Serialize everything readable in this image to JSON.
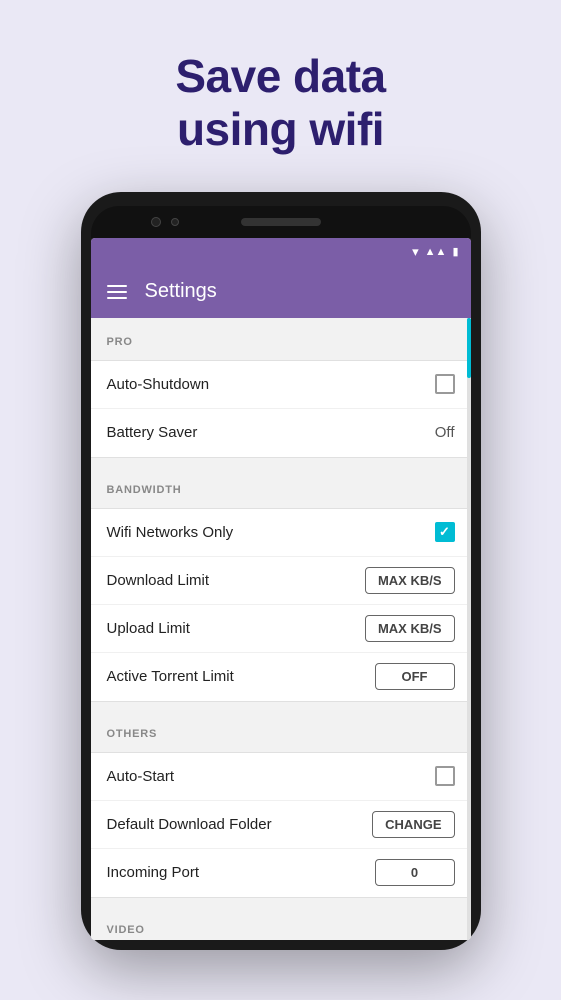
{
  "hero": {
    "line1": "Save data",
    "line2": "using wifi"
  },
  "appbar": {
    "title": "Settings"
  },
  "sections": {
    "pro": {
      "header": "PRO",
      "items": [
        {
          "label": "Auto-Shutdown",
          "control": "checkbox",
          "value": false
        },
        {
          "label": "Battery Saver",
          "control": "text",
          "value": "Off"
        }
      ]
    },
    "bandwidth": {
      "header": "BANDWIDTH",
      "items": [
        {
          "label": "Wifi Networks Only",
          "control": "checkbox-checked",
          "value": true
        },
        {
          "label": "Download Limit",
          "control": "button",
          "value": "MAX KB/S"
        },
        {
          "label": "Upload Limit",
          "control": "button",
          "value": "MAX KB/S"
        },
        {
          "label": "Active Torrent Limit",
          "control": "button",
          "value": "OFF"
        }
      ]
    },
    "others": {
      "header": "OTHERS",
      "items": [
        {
          "label": "Auto-Start",
          "control": "checkbox",
          "value": false
        },
        {
          "label": "Default Download Folder",
          "control": "button",
          "value": "CHANGE"
        },
        {
          "label": "Incoming Port",
          "control": "button",
          "value": "0"
        }
      ]
    },
    "video": {
      "header": "VIDEO",
      "items": []
    }
  },
  "icons": {
    "wifi": "▾",
    "signal": "▲▲",
    "battery": "▮"
  }
}
